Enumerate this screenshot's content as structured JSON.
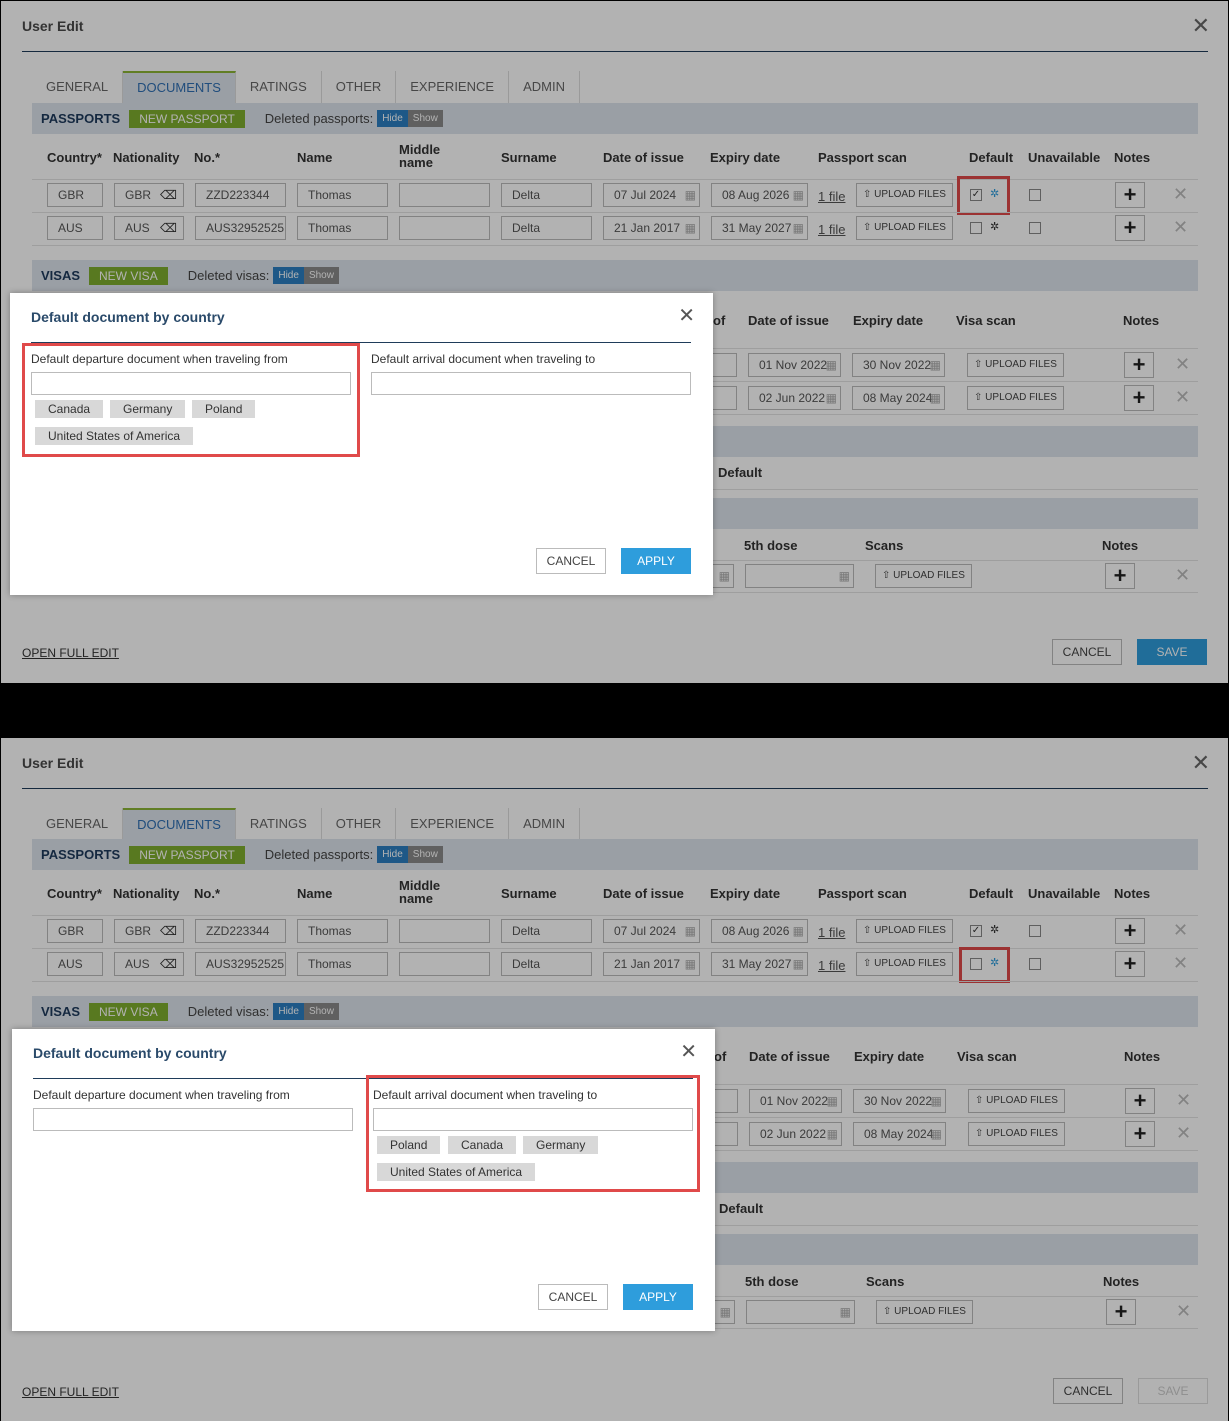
{
  "window": {
    "title": "User Edit"
  },
  "tabs": [
    "GENERAL",
    "DOCUMENTS",
    "RATINGS",
    "OTHER",
    "EXPERIENCE",
    "ADMIN"
  ],
  "passports": {
    "label": "PASSPORTS",
    "new_button": "NEW PASSPORT",
    "deleted_label": "Deleted passports:",
    "hide": "Hide",
    "show": "Show",
    "headers": {
      "country": "Country*",
      "nationality": "Nationality",
      "number": "No.*",
      "name": "Name",
      "middle": "Middle name",
      "surname": "Surname",
      "date_of_issue": "Date of issue",
      "expiry_date": "Expiry date",
      "scan": "Passport scan",
      "default": "Default",
      "unavailable": "Unavailable",
      "notes": "Notes"
    },
    "rows": [
      {
        "country": "GBR",
        "nationality": "GBR",
        "number": "ZZD223344",
        "name": "Thomas",
        "middle": "",
        "surname": "Delta",
        "issue": "07 Jul 2024",
        "expiry": "08 Aug 2026",
        "files": "1 file",
        "upload": "UPLOAD FILES"
      },
      {
        "country": "AUS",
        "nationality": "AUS",
        "number": "AUS32952525",
        "name": "Thomas",
        "middle": "",
        "surname": "Delta",
        "issue": "21 Jan 2017",
        "expiry": "31 May 2027",
        "files": "1 file",
        "upload": "UPLOAD FILES"
      }
    ]
  },
  "visas": {
    "label": "VISAS",
    "new_button": "NEW VISA",
    "deleted_label": "Deleted visas:",
    "hide": "Hide",
    "show": "Show",
    "headers": {
      "of": "of",
      "date_of_issue": "Date of issue",
      "expiry_date": "Expiry date",
      "scan": "Visa scan",
      "notes": "Notes"
    },
    "rows": [
      {
        "issue": "01 Nov 2022",
        "expiry": "30 Nov 2022",
        "upload": "UPLOAD FILES"
      },
      {
        "issue": "02 Jun 2022",
        "expiry": "08 May 2024",
        "upload": "UPLOAD FILES"
      }
    ]
  },
  "other_section": {
    "default_header": "Default"
  },
  "vaccines": {
    "headers": {
      "dose5": "5th dose",
      "scans": "Scans",
      "notes": "Notes"
    },
    "upload": "UPLOAD FILES"
  },
  "footer": {
    "open_full_edit": "OPEN FULL EDIT",
    "cancel": "CANCEL",
    "save": "SAVE"
  },
  "modal": {
    "title": "Default document by country",
    "departure_label": "Default departure document when traveling from",
    "arrival_label": "Default arrival document when traveling to",
    "cancel": "CANCEL",
    "apply": "APPLY"
  },
  "top_modal": {
    "departure_chips": [
      "Canada",
      "Germany",
      "Poland",
      "United States of America"
    ],
    "arrival_chips": []
  },
  "bottom_modal": {
    "departure_chips": [],
    "arrival_chips": [
      "Poland",
      "Canada",
      "Germany",
      "United States of America"
    ]
  },
  "state": {
    "top": {
      "gbr_default_checked": true,
      "aus_default_checked": false,
      "save_enabled": true
    },
    "bottom": {
      "gbr_default_checked": true,
      "aus_default_checked": false,
      "save_enabled": false
    }
  },
  "colors": {
    "accent_green": "#7fae2e",
    "primary_blue": "#2e9ddc",
    "highlight_red": "#e04a4a",
    "section_bg": "#dde4ec"
  }
}
